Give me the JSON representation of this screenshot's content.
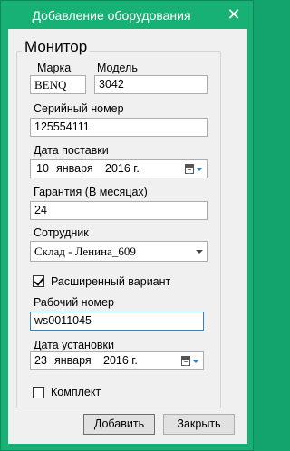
{
  "window": {
    "title": "Добавление оборудования",
    "close_glyph": "✕"
  },
  "group": {
    "title": "Монитор"
  },
  "fields": {
    "brand": {
      "label": "Марка",
      "value": "BENQ"
    },
    "model": {
      "label": "Модель",
      "value": "3042"
    },
    "serial": {
      "label": "Серийный номер",
      "value": "125554111"
    },
    "delivery_date": {
      "label": "Дата поставки",
      "day": "10",
      "month": "января",
      "year": "2016 г."
    },
    "warranty": {
      "label": "Гарантия (В месяцах)",
      "value": "24"
    },
    "employee": {
      "label": "Сотрудник",
      "value": "Склад - Ленина_609"
    },
    "extended": {
      "label": "Расширенный вариант",
      "checked": true
    },
    "work_number": {
      "label": "Рабочий номер",
      "value": "ws0011045"
    },
    "install_date": {
      "label": "Дата установки",
      "day": "23",
      "month": "января",
      "year": "2016 г."
    },
    "kit": {
      "label": "Комплект",
      "checked": false
    }
  },
  "buttons": {
    "add": "Добавить",
    "close": "Закрыть"
  }
}
